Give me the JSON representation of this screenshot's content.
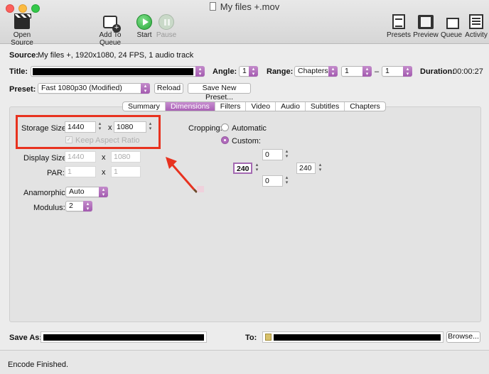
{
  "window": {
    "title": "My files +.mov"
  },
  "toolbar": {
    "open_source": "Open Source",
    "add_to_queue": "Add To Queue",
    "start": "Start",
    "pause": "Pause",
    "presets": "Presets",
    "preview": "Preview",
    "queue": "Queue",
    "activity": "Activity"
  },
  "source": {
    "label": "Source:",
    "value": "My files +, 1920x1080, 24 FPS, 1 audio track"
  },
  "title_row": {
    "title_label": "Title:",
    "angle_label": "Angle:",
    "angle_value": "1",
    "range_label": "Range:",
    "range_type": "Chapters",
    "range_start": "1",
    "range_dash": "–",
    "range_end": "1",
    "duration_label": "Duration:",
    "duration_value": "00:00:27"
  },
  "preset": {
    "label": "Preset:",
    "value": "Fast 1080p30 (Modified)",
    "reload": "Reload",
    "save_new": "Save New Preset..."
  },
  "tabs": [
    "Summary",
    "Dimensions",
    "Filters",
    "Video",
    "Audio",
    "Subtitles",
    "Chapters"
  ],
  "active_tab": "Dimensions",
  "dimensions": {
    "storage_size_label": "Storage Size:",
    "storage_w": "1440",
    "storage_h": "1080",
    "x": "x",
    "keep_aspect": "Keep Aspect Ratio",
    "display_size_label": "Display Size:",
    "display_w": "1440",
    "display_h": "1080",
    "par_label": "PAR:",
    "par_w": "1",
    "par_h": "1",
    "anamorphic_label": "Anamorphic:",
    "anamorphic_value": "Auto",
    "modulus_label": "Modulus:",
    "modulus_value": "2",
    "cropping_label": "Cropping:",
    "crop_auto": "Automatic",
    "crop_custom": "Custom:",
    "crop_top": "0",
    "crop_left": "240",
    "crop_right": "240",
    "crop_bottom": "0"
  },
  "save": {
    "save_as_label": "Save As:",
    "to_label": "To:",
    "browse": "Browse..."
  },
  "status": "Encode Finished.",
  "colors": {
    "accent": "#a95fb5",
    "annotation": "#e8321f"
  }
}
